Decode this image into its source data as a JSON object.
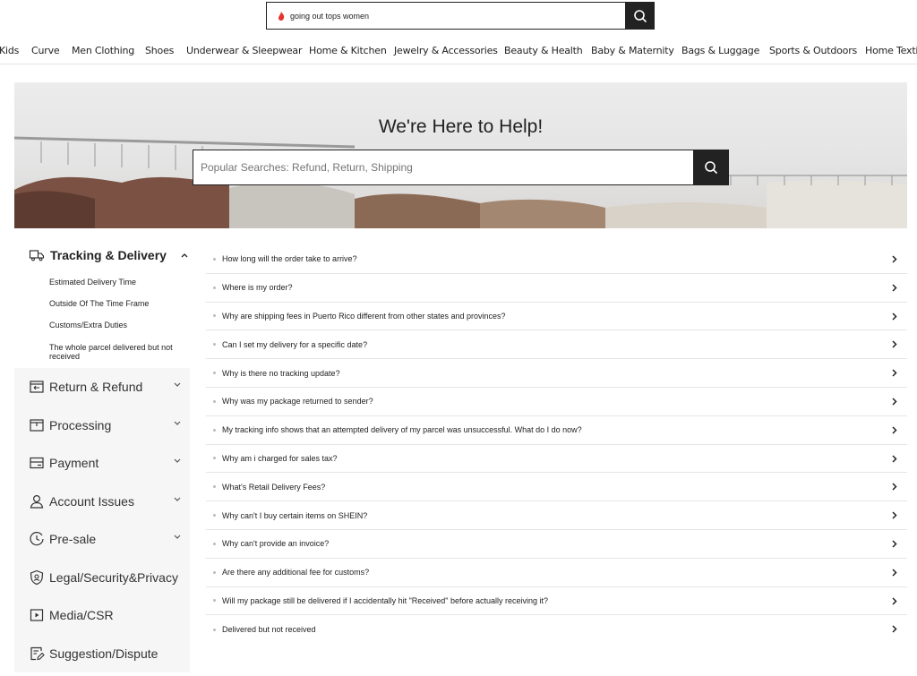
{
  "top_search": {
    "query": "going out tops women",
    "icons": {
      "hot": "flame-icon",
      "search": "search-icon"
    }
  },
  "categories": [
    "Kids",
    "Curve",
    "Men Clothing",
    "Shoes",
    "Underwear & Sleepwear",
    "Home & Kitchen",
    "Jewelry & Accessories",
    "Beauty & Health",
    "Baby & Maternity",
    "Bags & Luggage",
    "Sports & Outdoors",
    "Home Textil"
  ],
  "hero": {
    "title": "We're Here to Help!",
    "search_placeholder": "Popular Searches: Refund, Return, Shipping"
  },
  "sidebar": {
    "active": {
      "label": "Tracking & Delivery",
      "icon": "truck-icon",
      "subitems": [
        "Estimated Delivery Time",
        "Outside Of The Time Frame",
        "Customs/Extra Duties",
        "The whole parcel delivered but not received"
      ]
    },
    "items": [
      {
        "label": "Return & Refund",
        "icon": "return-box-icon",
        "expandable": true
      },
      {
        "label": "Processing",
        "icon": "package-icon",
        "expandable": true
      },
      {
        "label": "Payment",
        "icon": "credit-card-icon",
        "expandable": true
      },
      {
        "label": "Account Issues",
        "icon": "user-icon",
        "expandable": true
      },
      {
        "label": "Pre-sale",
        "icon": "clock-icon",
        "expandable": true
      },
      {
        "label": "Legal/Security&Privacy",
        "icon": "shield-icon",
        "expandable": false
      },
      {
        "label": "Media/CSR",
        "icon": "play-icon",
        "expandable": false
      },
      {
        "label": "Suggestion/Dispute",
        "icon": "feedback-icon",
        "expandable": false
      }
    ]
  },
  "faq": [
    "How long will the order take to arrive?",
    "Where is my order?",
    "Why are shipping fees in Puerto Rico different from other states and provinces?",
    "Can I set my delivery for a specific date?",
    "Why is there no tracking update?",
    "Why was my package returned to sender?",
    "My tracking info shows that an attempted delivery of my parcel was unsuccessful. What do I do now?",
    "Why am i charged for sales tax?",
    "What's Retail Delivery Fees?",
    "Why can't I buy certain items on SHEIN?",
    "Why can't provide an invoice?",
    "Are there any additional fee for customs?",
    "Will my package still be delivered if I accidentally hit \"Received\" before actually receiving it?",
    "Delivered but not received"
  ]
}
